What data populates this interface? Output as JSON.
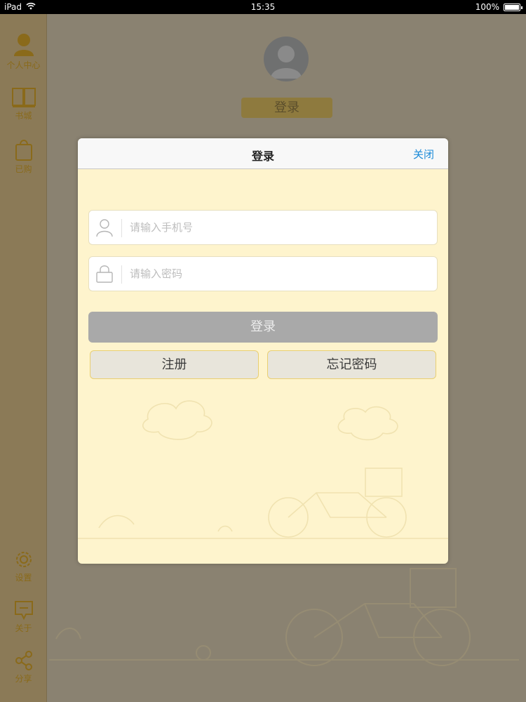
{
  "status_bar": {
    "device": "iPad",
    "time": "15:35",
    "battery": "100%"
  },
  "sidebar": {
    "items": [
      {
        "label": "个人中心",
        "icon": "person-icon"
      },
      {
        "label": "书城",
        "icon": "book-icon"
      },
      {
        "label": "已购",
        "icon": "shopping-bag-icon"
      },
      {
        "label": "设置",
        "icon": "gear-icon"
      },
      {
        "label": "关于",
        "icon": "message-icon"
      },
      {
        "label": "分享",
        "icon": "share-icon"
      }
    ]
  },
  "background": {
    "login_label": "登录"
  },
  "modal": {
    "title": "登录",
    "close_label": "关闭",
    "phone_placeholder": "请输入手机号",
    "password_placeholder": "请输入密码",
    "login_button": "登录",
    "register_button": "注册",
    "forgot_button": "忘记密码"
  },
  "colors": {
    "accent": "#1a8ad8",
    "modal_background": "#fef4cd",
    "disabled_button": "#a9a9a9",
    "sidebar_text": "#8a6a1a"
  }
}
